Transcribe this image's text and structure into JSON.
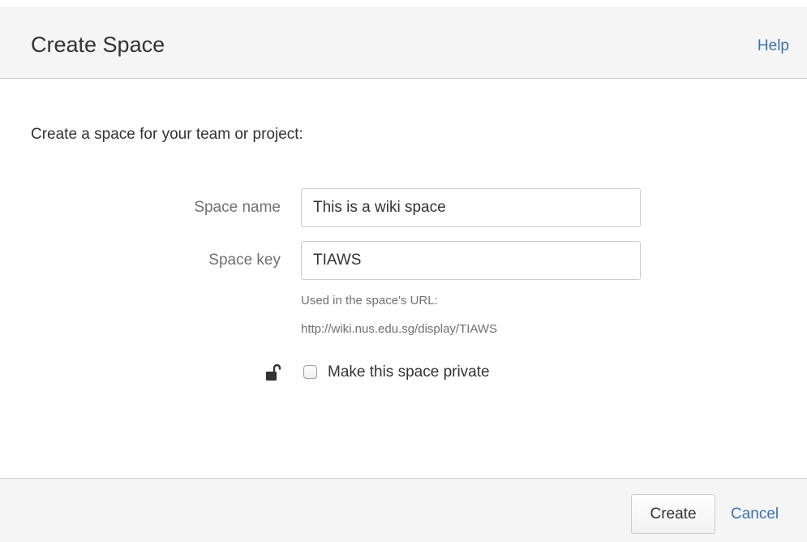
{
  "dialog": {
    "title": "Create Space",
    "help_label": "Help"
  },
  "intro": {
    "text": "Create a space for your team or project:"
  },
  "form": {
    "space_name": {
      "label": "Space name",
      "value": "This is a wiki space"
    },
    "space_key": {
      "label": "Space key",
      "value": "TIAWS",
      "hint_line1": "Used in the space's URL:",
      "hint_line2": "http://wiki.nus.edu.sg/display/TIAWS"
    },
    "private": {
      "icon": "unlocked-padlock-icon",
      "label": "Make this space private",
      "checked": false
    }
  },
  "footer": {
    "create_label": "Create",
    "cancel_label": "Cancel"
  },
  "colors": {
    "link": "#3b73af",
    "header_bg": "#f5f5f5",
    "muted_text": "#707070"
  }
}
